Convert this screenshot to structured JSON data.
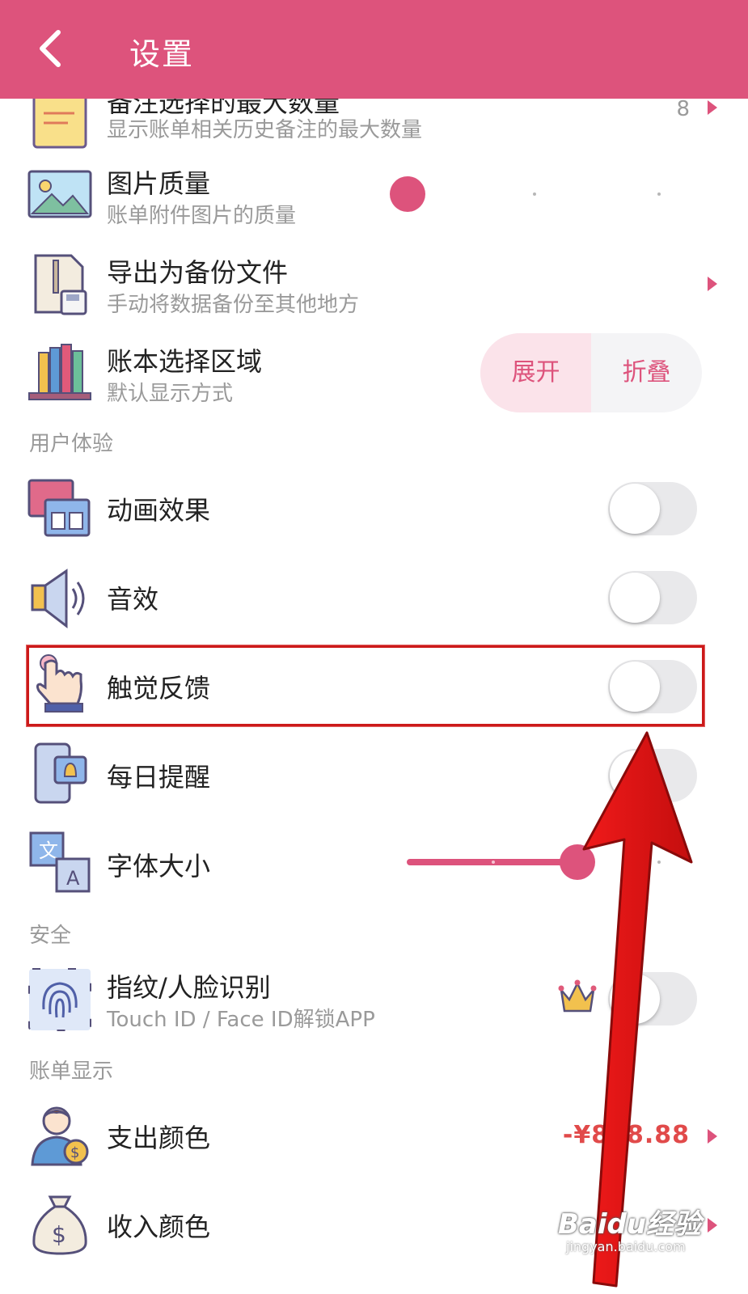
{
  "header": {
    "title": "设置"
  },
  "rows": {
    "note_max": {
      "title": "备注选择的最大数量",
      "subtitle": "显示账单相关历史备注的最大数量",
      "value": "8"
    },
    "image_quality": {
      "title": "图片质量",
      "subtitle": "账单附件图片的质量",
      "level": 0
    },
    "export_backup": {
      "title": "导出为备份文件",
      "subtitle": "手动将数据备份至其他地方"
    },
    "ledger_area": {
      "title": "账本选择区域",
      "subtitle": "默认显示方式",
      "options": [
        "展开",
        "折叠"
      ],
      "selected": "展开"
    }
  },
  "sections": {
    "ux": "用户体验",
    "security": "安全",
    "bill_display": "账单显示"
  },
  "ux": {
    "animation": {
      "title": "动画效果",
      "on": false
    },
    "sound": {
      "title": "音效",
      "on": false
    },
    "haptic": {
      "title": "触觉反馈",
      "on": false
    },
    "reminder": {
      "title": "每日提醒",
      "on": false
    },
    "font_size": {
      "title": "字体大小",
      "level": 0.5
    }
  },
  "security": {
    "biometric": {
      "title": "指纹/人脸识别",
      "subtitle": "Touch ID / Face ID解锁APP",
      "on": false
    }
  },
  "bill_display": {
    "expense_color": {
      "title": "支出颜色",
      "value": "-¥888.88"
    },
    "income_color": {
      "title": "收入颜色"
    }
  },
  "colors": {
    "accent": "#dd537c",
    "expense": "#e14a4a",
    "annotation": "#e8141a"
  },
  "watermark": {
    "text": "Baidu经验",
    "sub": "jingyan.baidu.com"
  }
}
